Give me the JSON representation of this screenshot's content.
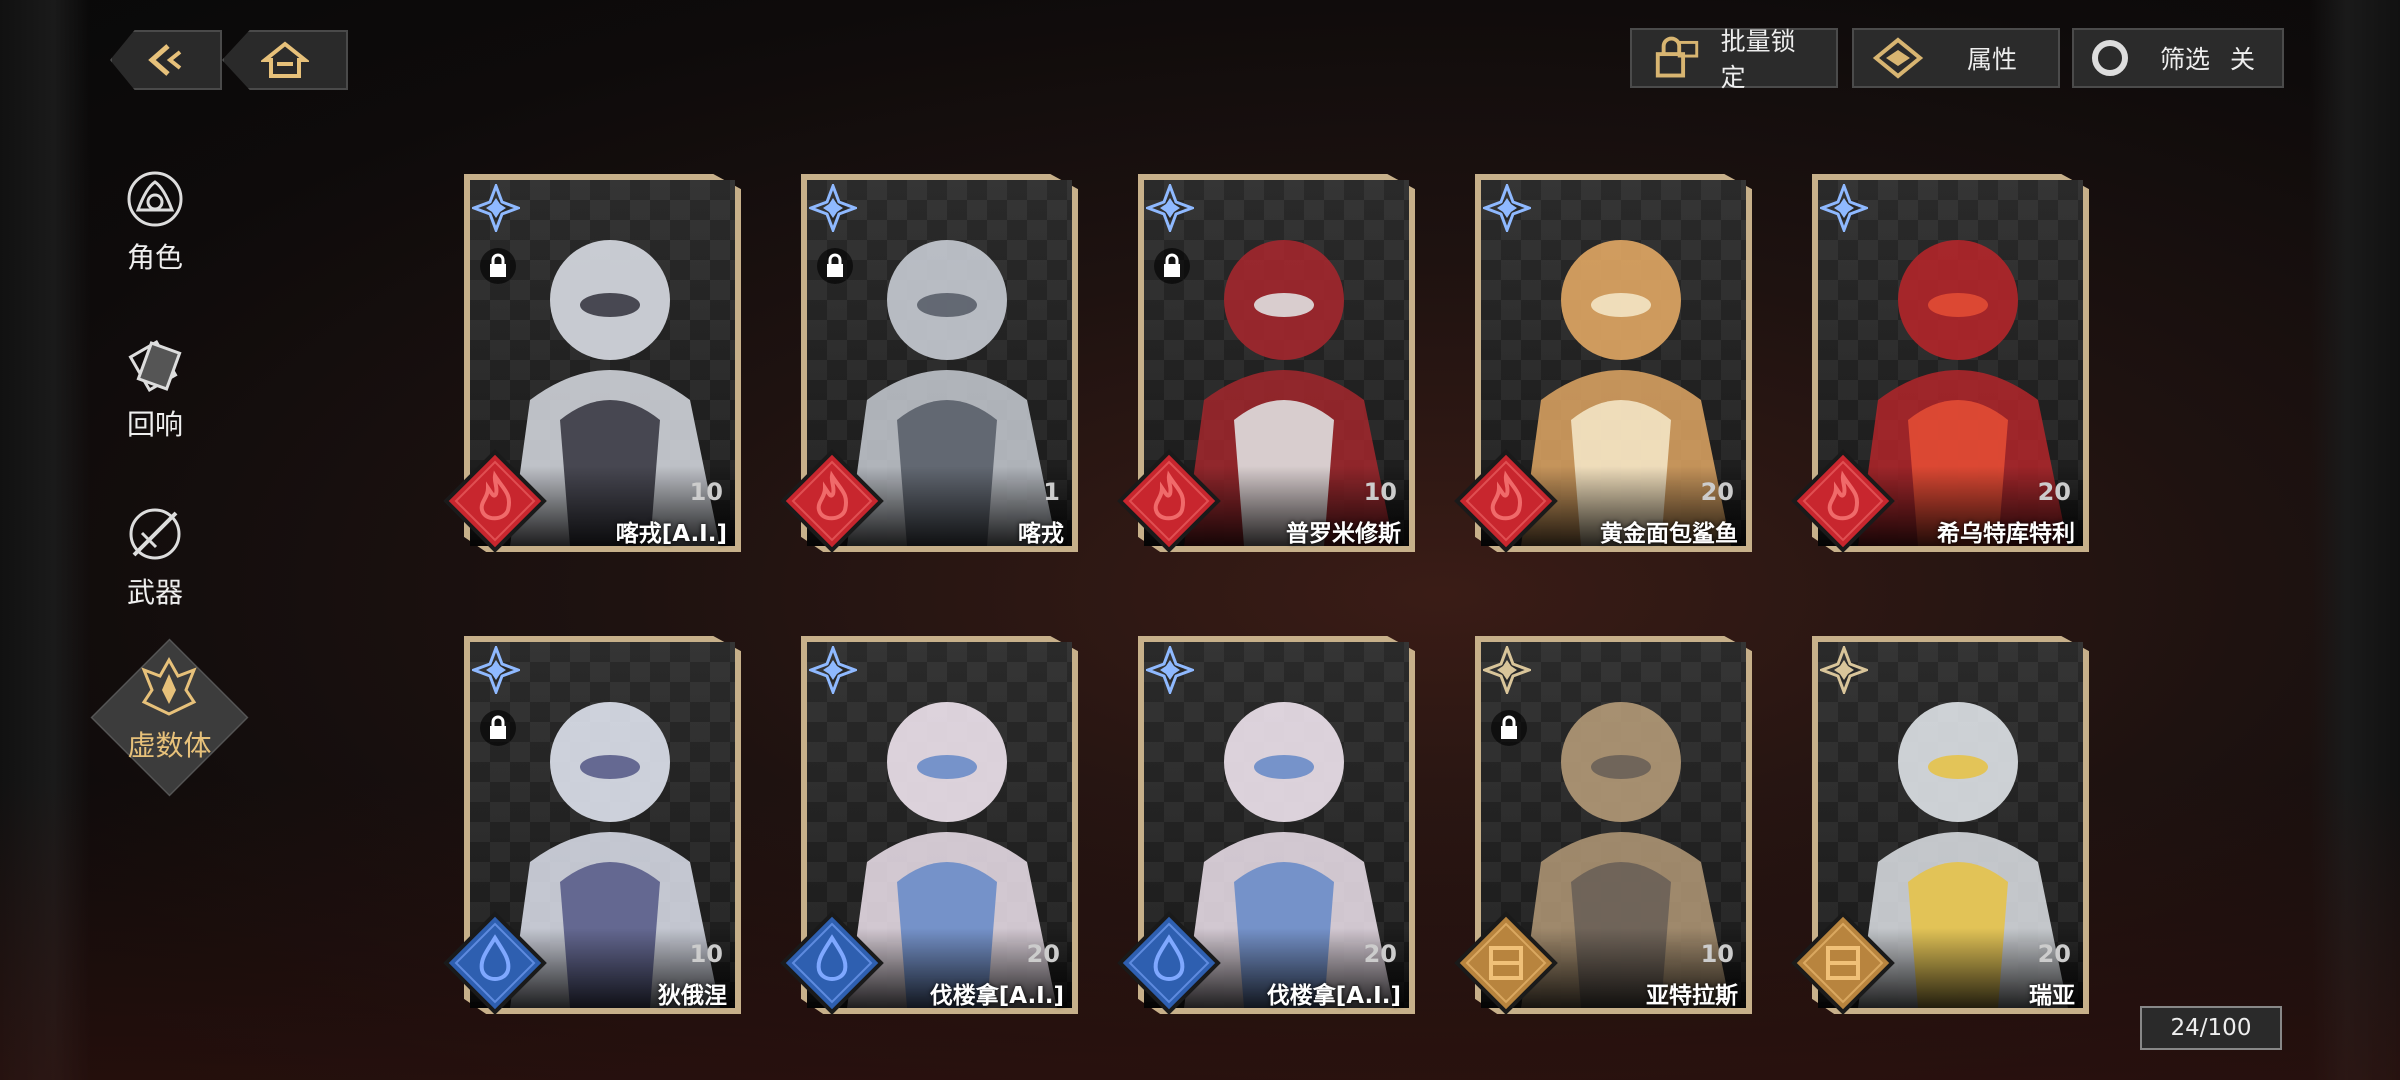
{
  "toolbar": {
    "batch_lock_label": "批量锁定",
    "attribute_label": "属性",
    "filter_label": "筛选",
    "filter_state": "关"
  },
  "tabs": {
    "character": "角色",
    "echo": "回响",
    "weapon": "武器",
    "virtual": "虚数体"
  },
  "cards": [
    {
      "name": "喀戎[A.I.]",
      "level": "10",
      "element": "fire",
      "locked": true
    },
    {
      "name": "喀戎",
      "level": "1",
      "element": "fire",
      "locked": true
    },
    {
      "name": "普罗米修斯",
      "level": "10",
      "element": "fire",
      "locked": true
    },
    {
      "name": "黄金面包鲨鱼",
      "level": "20",
      "element": "fire",
      "locked": false
    },
    {
      "name": "希乌特库特利",
      "level": "20",
      "element": "fire",
      "locked": false
    },
    {
      "name": "狄俄涅",
      "level": "10",
      "element": "water",
      "locked": true
    },
    {
      "name": "伐楼拿[A.I.]",
      "level": "20",
      "element": "water",
      "locked": false
    },
    {
      "name": "伐楼拿[A.I.]",
      "level": "20",
      "element": "water",
      "locked": false
    },
    {
      "name": "亚特拉斯",
      "level": "10",
      "element": "earth",
      "locked": true
    },
    {
      "name": "瑞亚",
      "level": "20",
      "element": "earth",
      "locked": false
    }
  ],
  "counter": "24/100",
  "colors": {
    "gold": "#c7b08a",
    "fire": "#c8262e",
    "water": "#2e5fb0",
    "earth": "#b8843e",
    "accent_text": "#e7c17a"
  },
  "icons": {
    "back": "back-arrow-icon",
    "home": "home-icon",
    "lock": "lock-icon",
    "attribute": "attribute-icon",
    "filter": "filter-circle-icon"
  }
}
